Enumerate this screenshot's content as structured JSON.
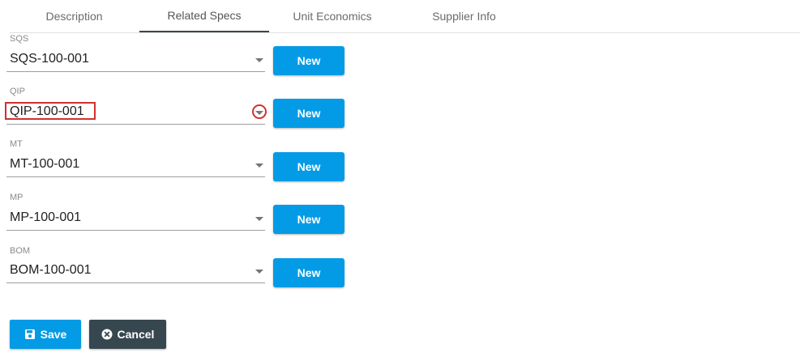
{
  "tabs": [
    {
      "label": "Description"
    },
    {
      "label": "Related Specs"
    },
    {
      "label": "Unit Economics"
    },
    {
      "label": "Supplier Info"
    }
  ],
  "active_tab": "Related Specs",
  "fields": [
    {
      "label": "SQS",
      "value": "SQS-100-001",
      "button": "New"
    },
    {
      "label": "QIP",
      "value": "QIP-100-001",
      "button": "New"
    },
    {
      "label": "MT",
      "value": "MT-100-001",
      "button": "New"
    },
    {
      "label": "MP",
      "value": "MP-100-001",
      "button": "New"
    },
    {
      "label": "BOM",
      "value": "BOM-100-001",
      "button": "New"
    }
  ],
  "actions": {
    "save_label": "Save",
    "cancel_label": "Cancel"
  },
  "colors": {
    "accent": "#039be5",
    "dark": "#37474f",
    "highlight": "#d32f2f"
  },
  "icons": {
    "save": "floppy-disk-icon",
    "cancel": "close-circle-icon",
    "dropdown": "dropdown-arrow-icon"
  }
}
